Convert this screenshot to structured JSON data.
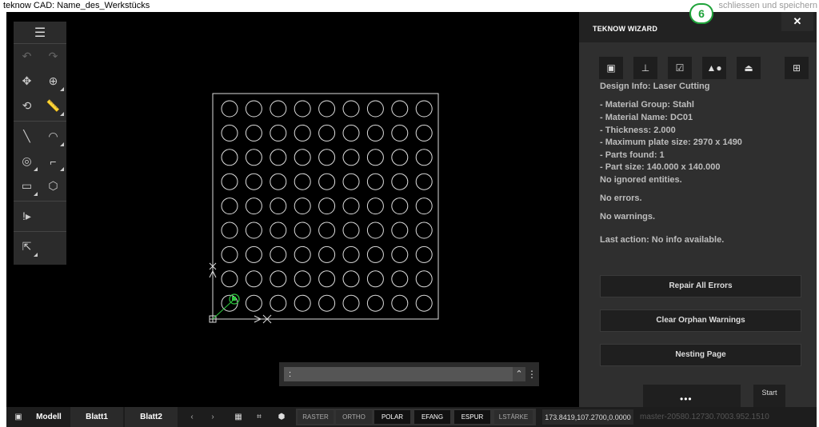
{
  "window": {
    "title": "teknow CAD: Name_des_Werkstücks",
    "close_link": "schliessen und speichern",
    "badge": "6"
  },
  "toolbar": {
    "menu_icon": "hamburger-menu-icon",
    "rows": [
      [
        "undo-icon",
        "redo-icon"
      ],
      [
        "move-icon",
        "zoom-window-icon"
      ],
      [
        "rotate-icon",
        "measure-icon"
      ],
      [
        "line-icon",
        "arc-icon"
      ],
      [
        "circle-icon",
        "polyline-icon"
      ],
      [
        "rectangle-icon",
        "polygon-icon"
      ],
      [
        "validate-icon"
      ],
      [
        "export-icon"
      ]
    ]
  },
  "drawing": {
    "grid_rows": 9,
    "grid_cols": 9
  },
  "command_bar": {
    "input_value": ":"
  },
  "wizard": {
    "title": "TEKNOW WIZARD",
    "close": "✕",
    "icons": [
      "design-info-icon",
      "material-icon",
      "check-icon",
      "parts-icon",
      "layers-icon",
      "nesting-icon"
    ],
    "info": [
      "Design Info: Laser Cutting",
      "- Material Group: Stahl",
      "- Material Name: DC01",
      "- Thickness: 2.000",
      "- Maximum plate size: 2970 x 1490",
      "- Parts found: 1",
      "- Part size: 140.000 x 140.000",
      "No ignored entities.",
      "No errors.",
      "No warnings.",
      "Last action: No info available."
    ],
    "buttons": [
      "Repair All Errors",
      "Clear Orphan Warnings",
      "Nesting Page"
    ],
    "footer_dots": "•••",
    "start_label": "Start"
  },
  "statusbar": {
    "tabs": [
      "Modell",
      "Blatt1",
      "Blatt2"
    ],
    "toggles": [
      {
        "label": "RASTER",
        "on": false
      },
      {
        "label": "ORTHO",
        "on": false
      },
      {
        "label": "POLAR",
        "on": true
      },
      {
        "label": "EFANG",
        "on": true
      },
      {
        "label": "ESPUR",
        "on": true
      },
      {
        "label": "LSTÄRKE",
        "on": false
      }
    ],
    "coords": "173.8419,107.2700,0.0000",
    "version": "master-20580.12730.7003.952.1510"
  }
}
